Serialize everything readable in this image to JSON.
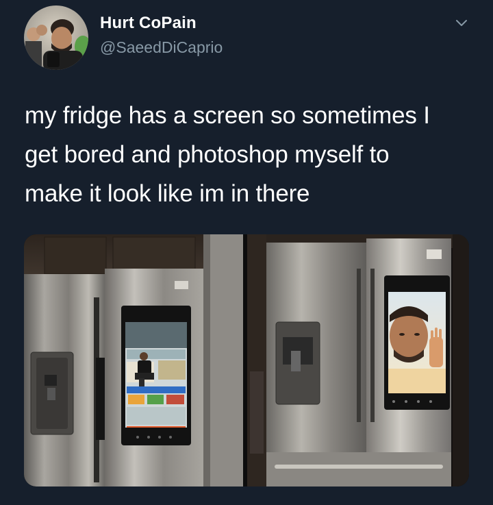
{
  "author": {
    "display_name": "Hurt CoPain",
    "handle": "@SaeedDiCaprio"
  },
  "tweet": {
    "text_lines": [
      "my fridge has a screen so sometimes I",
      "get bored and photoshop myself to",
      "make it look like im in there"
    ]
  },
  "icons": {
    "avatar": "avatar-photo",
    "menu": "chevron-down-icon"
  },
  "colors": {
    "background": "#161f2c",
    "secondary_text": "#8899a6",
    "primary_text": "#ffffff"
  }
}
